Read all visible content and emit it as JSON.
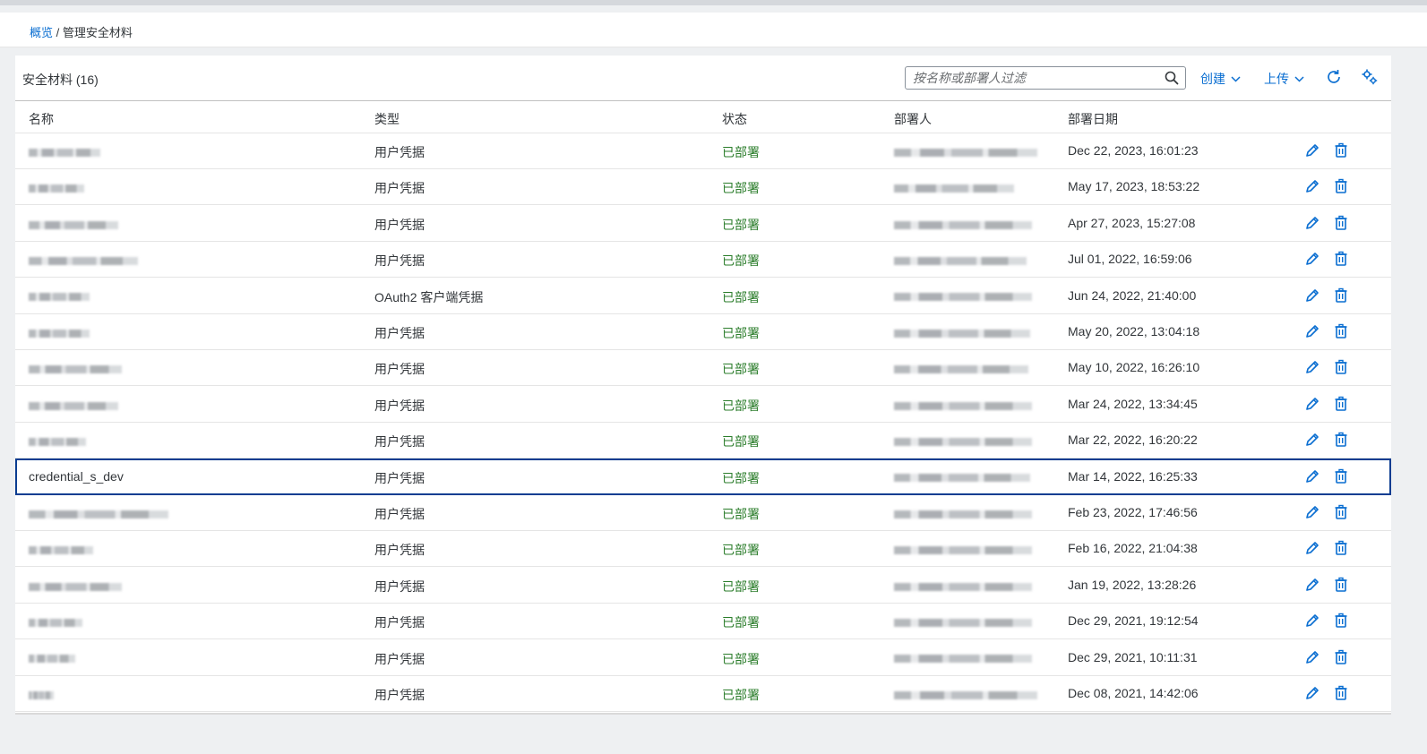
{
  "breadcrumb": {
    "root": "概览",
    "separator": "/",
    "current": "管理安全材料"
  },
  "toolbar": {
    "title": "安全材料 (16)",
    "search_placeholder": "按名称或部署人过滤",
    "create_label": "创建",
    "upload_label": "上传",
    "refresh_icon": "refresh-icon",
    "settings_icon": "settings-icon"
  },
  "columns": {
    "name": "名称",
    "type": "类型",
    "status": "状态",
    "deployed_by": "部署人",
    "deployed_on": "部署日期"
  },
  "rows": [
    {
      "name": "",
      "type": "用户凭据",
      "status": "已部署",
      "deployed_by": "",
      "deployed_on": "Dec 22, 2023, 16:01:23"
    },
    {
      "name": "",
      "type": "用户凭据",
      "status": "已部署",
      "deployed_by": "",
      "deployed_on": "May 17, 2023, 18:53:22"
    },
    {
      "name": "",
      "type": "用户凭据",
      "status": "已部署",
      "deployed_by": "",
      "deployed_on": "Apr 27, 2023, 15:27:08"
    },
    {
      "name": "",
      "type": "用户凭据",
      "status": "已部署",
      "deployed_by": "",
      "deployed_on": "Jul 01, 2022, 16:59:06"
    },
    {
      "name": "",
      "type": "OAuth2 客户端凭据",
      "status": "已部署",
      "deployed_by": "",
      "deployed_on": "Jun 24, 2022, 21:40:00"
    },
    {
      "name": "",
      "type": "用户凭据",
      "status": "已部署",
      "deployed_by": "",
      "deployed_on": "May 20, 2022, 13:04:18"
    },
    {
      "name": "",
      "type": "用户凭据",
      "status": "已部署",
      "deployed_by": "",
      "deployed_on": "May 10, 2022, 16:26:10"
    },
    {
      "name": "",
      "type": "用户凭据",
      "status": "已部署",
      "deployed_by": "",
      "deployed_on": "Mar 24, 2022, 13:34:45"
    },
    {
      "name": "",
      "type": "用户凭据",
      "status": "已部署",
      "deployed_by": "",
      "deployed_on": "Mar 22, 2022, 16:20:22"
    },
    {
      "name": "credential_s_dev",
      "type": "用户凭据",
      "status": "已部署",
      "deployed_by": "",
      "deployed_on": "Mar 14, 2022, 16:25:33",
      "selected": true
    },
    {
      "name": "",
      "type": "用户凭据",
      "status": "已部署",
      "deployed_by": "",
      "deployed_on": "Feb 23, 2022, 17:46:56"
    },
    {
      "name": "",
      "type": "用户凭据",
      "status": "已部署",
      "deployed_by": "",
      "deployed_on": "Feb 16, 2022, 21:04:38"
    },
    {
      "name": "",
      "type": "用户凭据",
      "status": "已部署",
      "deployed_by": "",
      "deployed_on": "Jan 19, 2022, 13:28:26"
    },
    {
      "name": "",
      "type": "用户凭据",
      "status": "已部署",
      "deployed_by": "",
      "deployed_on": "Dec 29, 2021, 19:12:54"
    },
    {
      "name": "",
      "type": "用户凭据",
      "status": "已部署",
      "deployed_by": "",
      "deployed_on": "Dec 29, 2021, 10:11:31"
    },
    {
      "name": "",
      "type": "用户凭据",
      "status": "已部署",
      "deployed_by": "",
      "deployed_on": "Dec 08, 2021, 14:42:06"
    }
  ],
  "colors": {
    "accent": "#0a6ed1",
    "status_deployed": "#2b7d2b",
    "selection_border": "#0b3d91"
  },
  "row_icons": {
    "edit": "pencil-icon",
    "delete": "trash-icon"
  }
}
